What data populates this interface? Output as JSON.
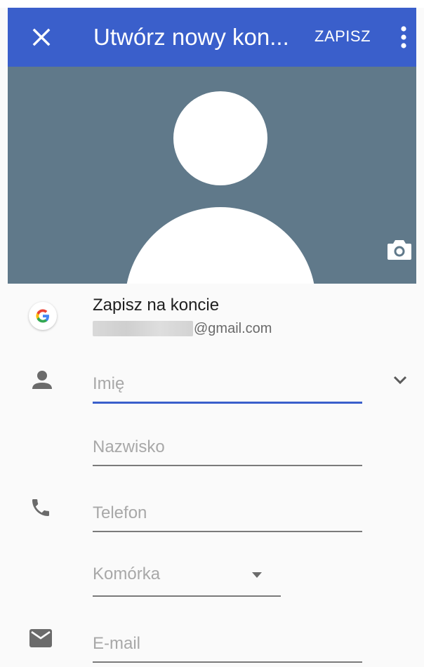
{
  "app_bar": {
    "title": "Utwórz nowy kon...",
    "save_label": "ZAPISZ",
    "close_icon": "close-icon",
    "more_icon": "more-vert-icon",
    "color": "#3a5fcb"
  },
  "photo": {
    "background": "#60798a",
    "camera_icon": "camera-icon"
  },
  "account": {
    "title": "Zapisz na koncie",
    "email_suffix": "@gmail.com",
    "icon": "google-logo-icon"
  },
  "form": {
    "first_name_placeholder": "Imię",
    "last_name_placeholder": "Nazwisko",
    "phone_placeholder": "Telefon",
    "phone_type": "Komórka",
    "email_placeholder": "E-mail"
  }
}
